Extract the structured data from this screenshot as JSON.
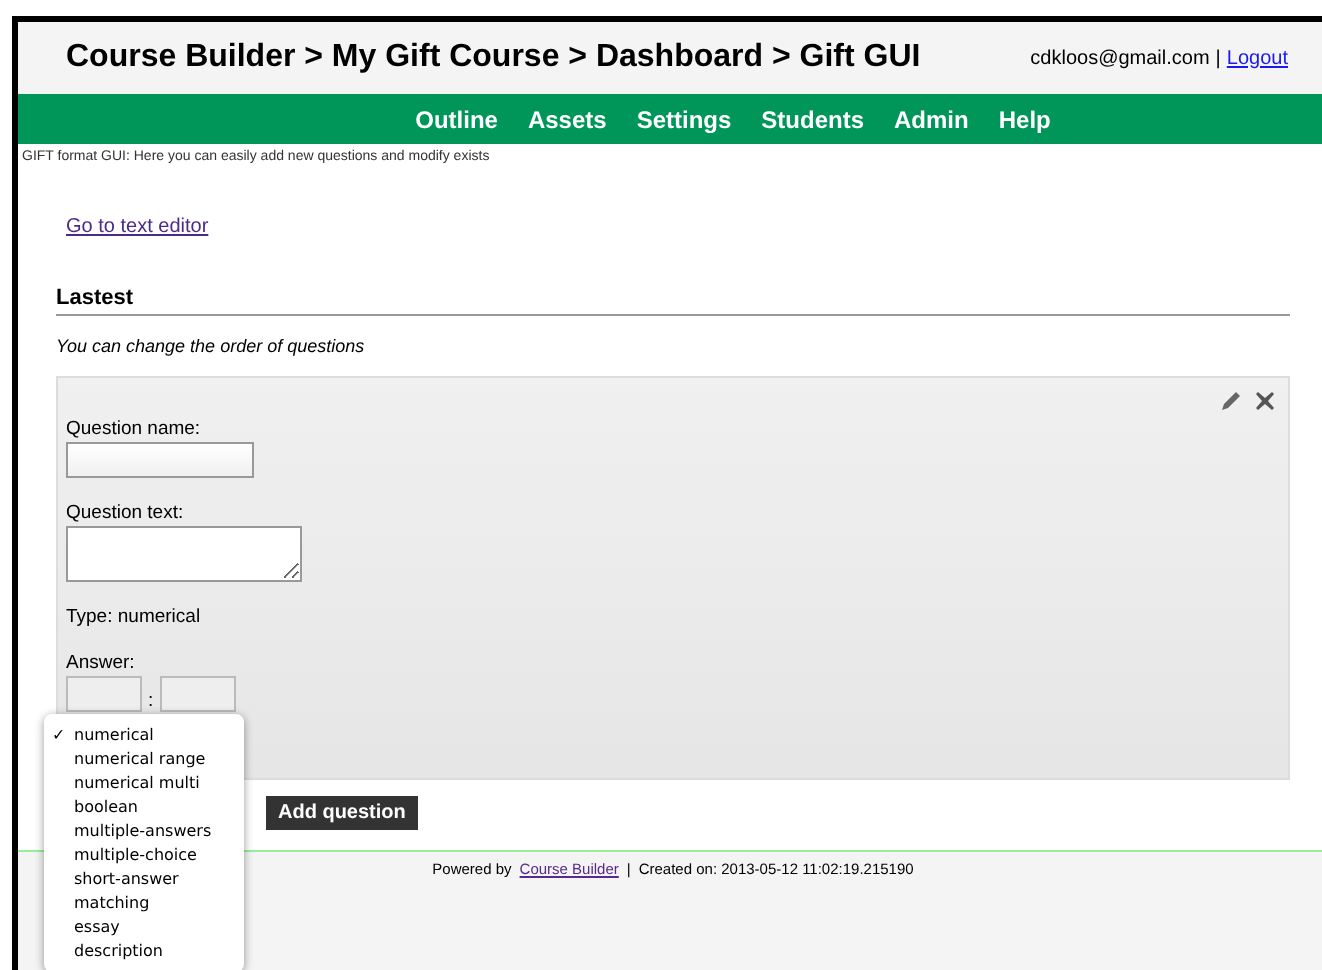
{
  "header": {
    "breadcrumb": "Course Builder > My Gift Course > Dashboard > Gift GUI",
    "user": "cdkloos@gmail.com",
    "separator": "|",
    "logout": "Logout"
  },
  "nav": [
    {
      "label": "Outline"
    },
    {
      "label": "Assets"
    },
    {
      "label": "Settings"
    },
    {
      "label": "Students"
    },
    {
      "label": "Admin"
    },
    {
      "label": "Help"
    }
  ],
  "hint": "GIFT format GUI: Here you can easily add new questions and modify exists",
  "editor_link": "Go to text editor",
  "section_title": "Lastest",
  "section_note": "You can change the order of questions",
  "question": {
    "name_label": "Question name:",
    "text_label": "Question text:",
    "type_text": "Type: numerical",
    "answer_label": "Answer:",
    "answer_separator": ":"
  },
  "add_button": "Add question",
  "type_menu": {
    "check": "✓",
    "items": [
      {
        "label": "numerical",
        "selected": true
      },
      {
        "label": "numerical range",
        "selected": false
      },
      {
        "label": "numerical multi",
        "selected": false
      },
      {
        "label": "boolean",
        "selected": false
      },
      {
        "label": "multiple-answers",
        "selected": false
      },
      {
        "label": "multiple-choice",
        "selected": false
      },
      {
        "label": "short-answer",
        "selected": false
      },
      {
        "label": "matching",
        "selected": false
      },
      {
        "label": "essay",
        "selected": false
      },
      {
        "label": "description",
        "selected": false
      }
    ]
  },
  "footer": {
    "powered": "Powered by",
    "link": "Course Builder",
    "separator": "|",
    "created": "Created on: 2013-05-12 11:02:19.215190"
  }
}
